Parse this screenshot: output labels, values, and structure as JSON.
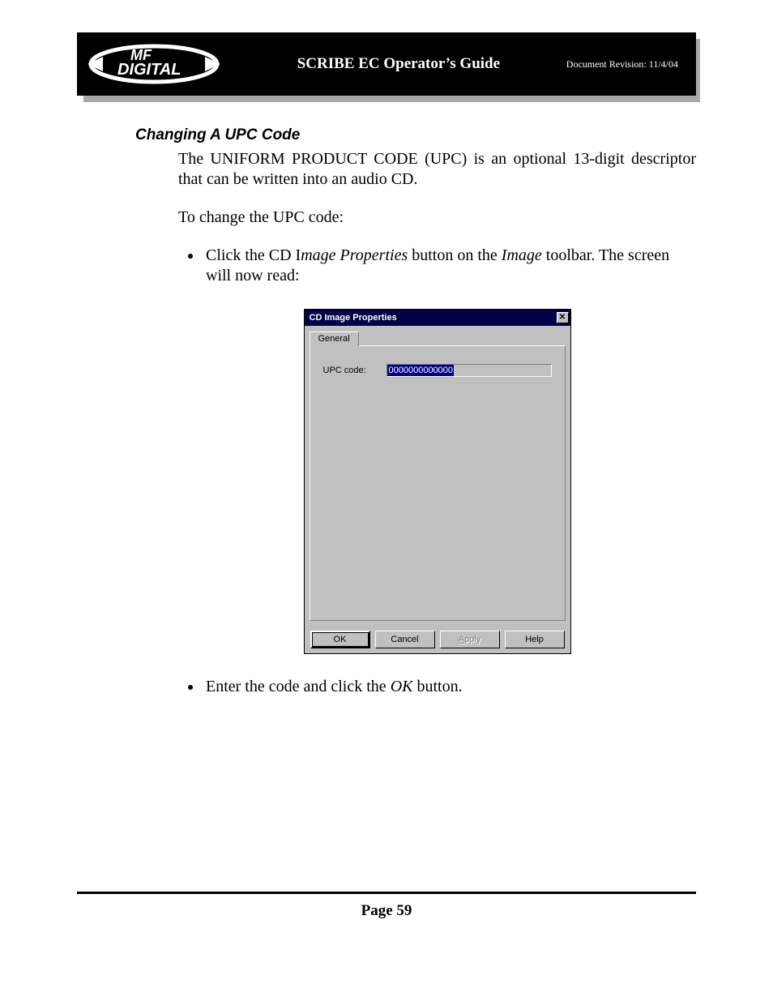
{
  "header": {
    "logo_line1": "MF",
    "logo_line2": "DIGITAL",
    "title": "SCRIBE EC Operator’s Guide",
    "revision": "Document Revision: 11/4/04"
  },
  "section": {
    "heading": "Changing A UPC Code",
    "para1": "The UNIFORM PRODUCT CODE (UPC) is an optional 13-digit descriptor that can be written into an audio CD.",
    "para2": "To change the UPC code:",
    "bullet1_pre": "Click the CD I",
    "bullet1_em1": "mage Properties",
    "bullet1_mid": " button on the ",
    "bullet1_em2": "Image",
    "bullet1_post": " toolbar. The screen will now read:",
    "bullet2_pre": "Enter the code and click the ",
    "bullet2_em": "OK",
    "bullet2_post": " button."
  },
  "dialog": {
    "title": "CD Image Properties",
    "close_glyph": "✕",
    "tab": "General",
    "field_label": "UPC code:",
    "field_value": "0000000000000",
    "buttons": {
      "ok": "OK",
      "cancel": "Cancel",
      "apply_underline": "A",
      "apply_rest": "pply",
      "help": "Help"
    }
  },
  "footer": {
    "page": "Page 59"
  }
}
